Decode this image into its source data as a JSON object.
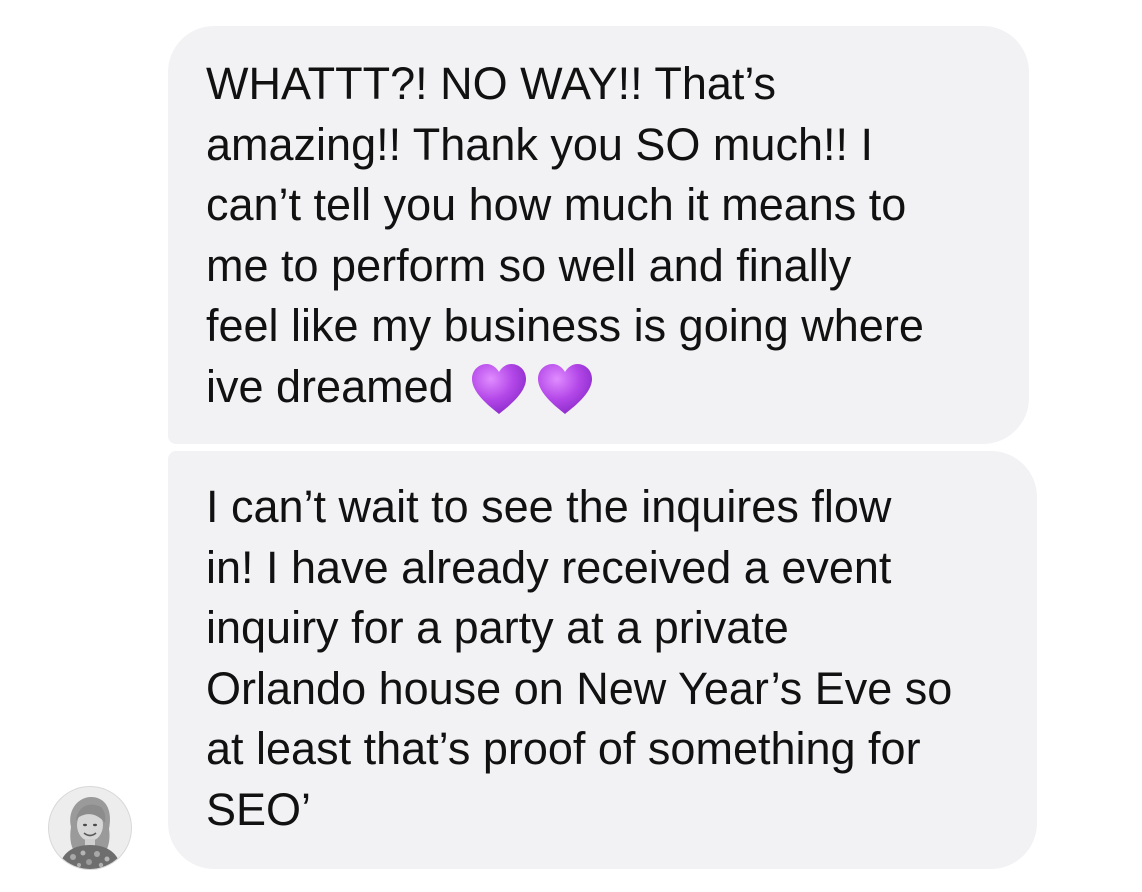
{
  "messages": [
    {
      "lines": [
        "WHATTT?! NO WAY!! That’s",
        "amazing!! Thank you  SO much!! I",
        "can’t tell you how much it means to",
        "me to perform so well and finally",
        "feel like my business is going where",
        "ive dreamed"
      ],
      "trailing_emoji": [
        "purple-heart",
        "purple-heart"
      ]
    },
    {
      "lines": [
        "I can’t wait to see the inquires flow",
        "in! I have already received a event",
        "inquiry for a party at a private",
        "Orlando house on New Year’s Eve so",
        "at least that’s proof of something for",
        "SEO’"
      ]
    }
  ],
  "colors": {
    "bubble_background": "#f2f2f5",
    "text": "#111111",
    "heart": "#b14ee6"
  },
  "avatar": {
    "icon": "user-avatar-photo"
  }
}
